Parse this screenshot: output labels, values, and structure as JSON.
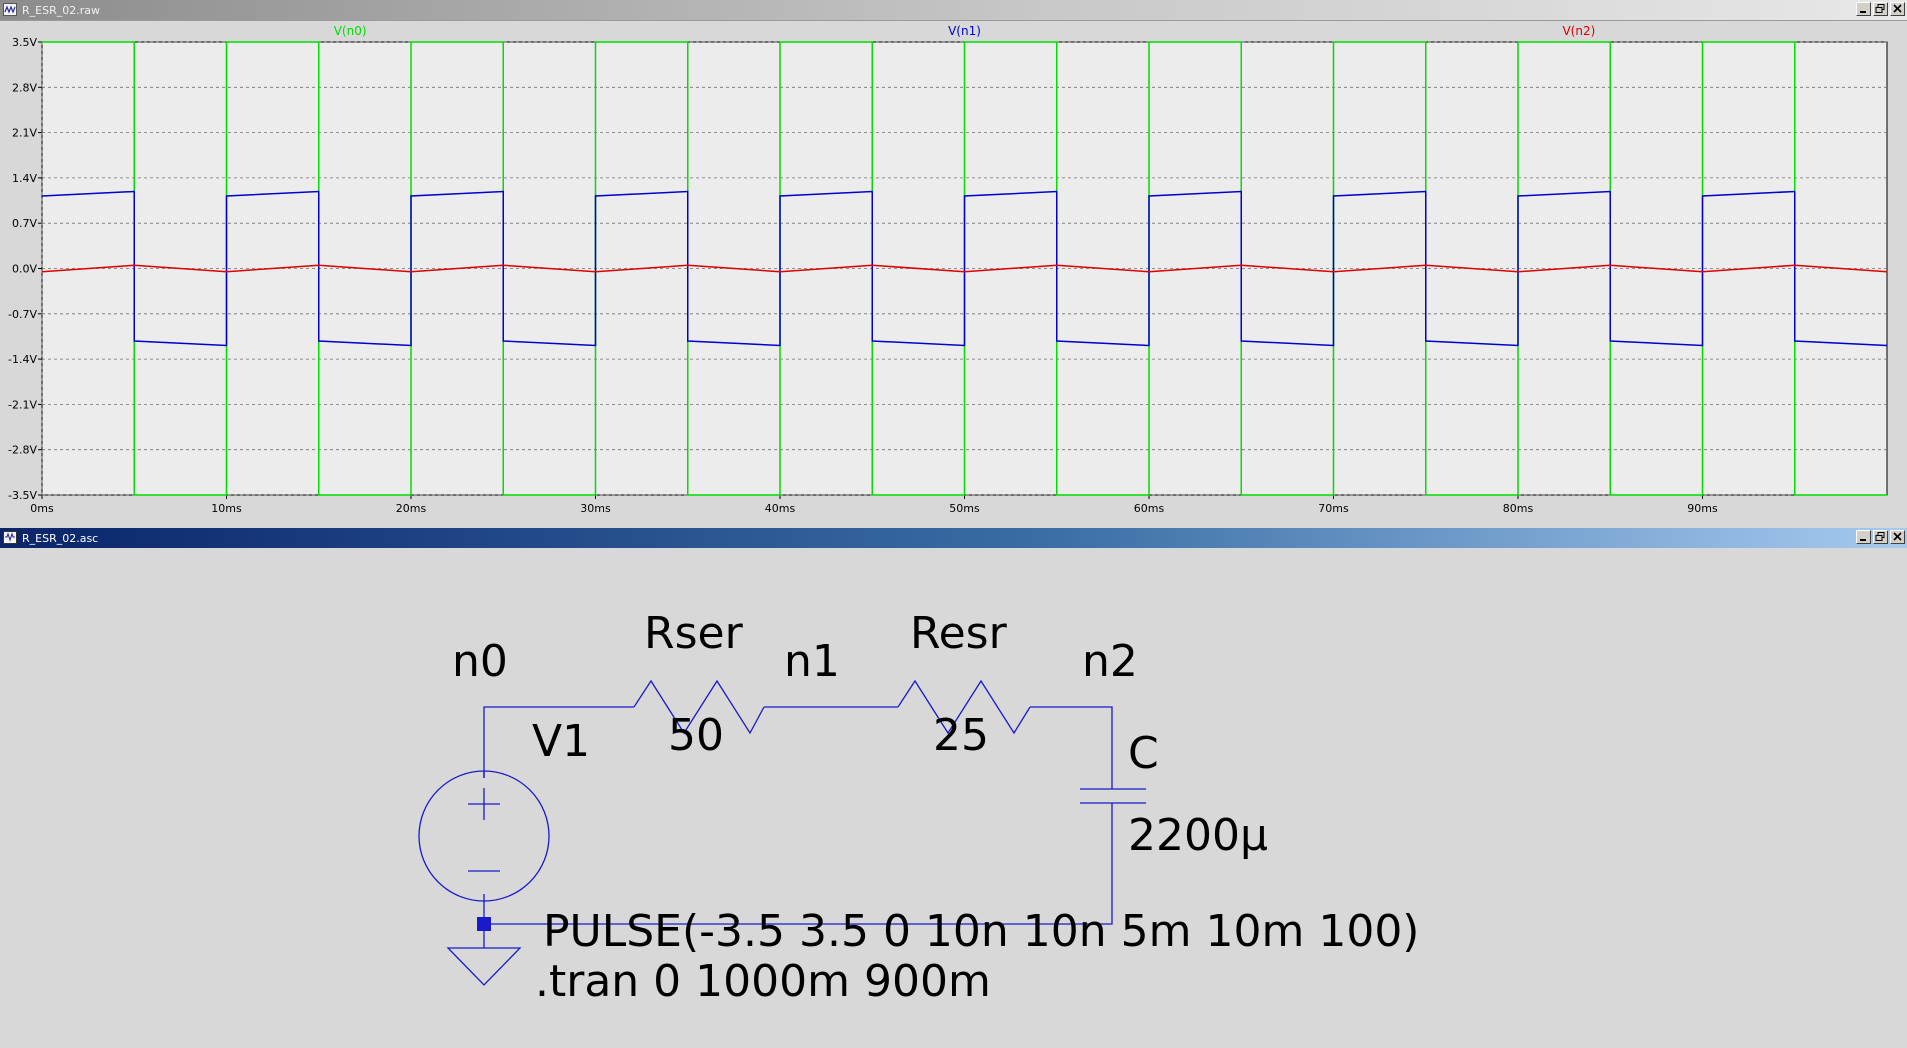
{
  "waveform_window": {
    "title": "R_ESR_02.raw",
    "traces": [
      {
        "name": "V(n0)",
        "color": "#00dd00"
      },
      {
        "name": "V(n1)",
        "color": "#0000cc"
      },
      {
        "name": "V(n2)",
        "color": "#dd0000"
      }
    ],
    "background": "#ececec"
  },
  "schematic_window": {
    "title": "R_ESR_02.asc",
    "wire_color": "#1a1acc",
    "nodes": {
      "n0": "n0",
      "n1": "n1",
      "n2": "n2"
    },
    "components": {
      "source_name": "V1",
      "r1_name": "Rser",
      "r1_value": "50",
      "r2_name": "Resr",
      "r2_value": "25",
      "c_name": "C",
      "c_value": "2200µ"
    },
    "directives": {
      "pulse": "PULSE(-3.5 3.5 0 10n 10n 5m 10m 100)",
      "tran": ".tran 0 1000m 900m"
    }
  },
  "chart_data": {
    "type": "line",
    "xlabel": "",
    "ylabel": "",
    "x_ticks": [
      "0ms",
      "10ms",
      "20ms",
      "30ms",
      "40ms",
      "50ms",
      "60ms",
      "70ms",
      "80ms",
      "90ms"
    ],
    "y_ticks": [
      "3.5V",
      "2.8V",
      "2.1V",
      "1.4V",
      "0.7V",
      "0.0V",
      "-0.7V",
      "-1.4V",
      "-2.1V",
      "-2.8V",
      "-3.5V"
    ],
    "xlim": [
      0,
      100
    ],
    "ylim": [
      -3.5,
      3.5
    ],
    "grid": true,
    "square_wave": {
      "period_ms": 10,
      "high_ms": 5,
      "start_high": true,
      "x_end_ms": 100
    },
    "series": [
      {
        "name": "V(n0)",
        "high": 3.5,
        "low": -3.5
      },
      {
        "name": "V(n1)",
        "high_start": 1.12,
        "high_end": 1.19,
        "low_start": -1.12,
        "low_end": -1.19
      },
      {
        "name": "V(n2)",
        "high_start": -0.05,
        "high_end": 0.05,
        "low_start": 0.05,
        "low_end": -0.05
      }
    ]
  }
}
